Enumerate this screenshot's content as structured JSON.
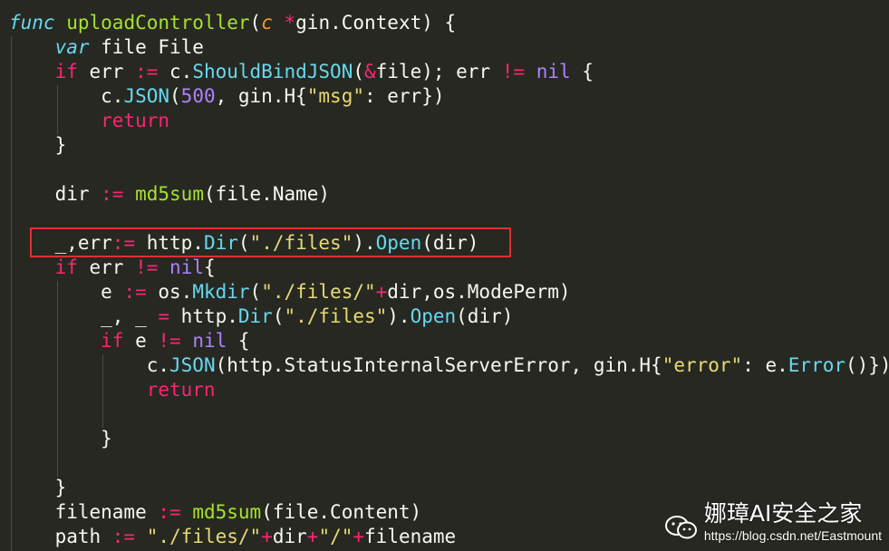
{
  "colors": {
    "background": "#272822",
    "keyword_blue": "#66d9ef",
    "keyword_pink": "#f92672",
    "function_green": "#a6e22e",
    "string_yellow": "#e6db74",
    "number_purple": "#ae81ff",
    "plain": "#f8f8f2",
    "param_orange": "#fd971f",
    "highlight_border": "#e03030"
  },
  "code": {
    "lines": [
      [
        [
          "func",
          "kwblue_i"
        ],
        [
          " ",
          "plain"
        ],
        [
          "uploadController",
          "fn"
        ],
        [
          "(",
          "plain"
        ],
        [
          "c",
          "param"
        ],
        [
          " ",
          "plain"
        ],
        [
          "*",
          "pink"
        ],
        [
          "gin.Context) {",
          "plain"
        ]
      ],
      [
        [
          "    ",
          "plain"
        ],
        [
          "var",
          "kwblue_i"
        ],
        [
          " file File",
          "plain"
        ]
      ],
      [
        [
          "    ",
          "plain"
        ],
        [
          "if",
          "pink"
        ],
        [
          " err ",
          "plain"
        ],
        [
          ":=",
          "pink"
        ],
        [
          " c.",
          "plain"
        ],
        [
          "ShouldBindJSON",
          "blue"
        ],
        [
          "(",
          "plain"
        ],
        [
          "&",
          "pink"
        ],
        [
          "file); err ",
          "plain"
        ],
        [
          "!=",
          "pink"
        ],
        [
          " ",
          "plain"
        ],
        [
          "nil",
          "purple"
        ],
        [
          " {",
          "plain"
        ]
      ],
      [
        [
          "        c.",
          "plain"
        ],
        [
          "JSON",
          "blue"
        ],
        [
          "(",
          "plain"
        ],
        [
          "500",
          "purple"
        ],
        [
          ", gin.H{",
          "plain"
        ],
        [
          "\"msg\"",
          "str"
        ],
        [
          ": err})",
          "plain"
        ]
      ],
      [
        [
          "        ",
          "plain"
        ],
        [
          "return",
          "pink"
        ]
      ],
      [
        [
          "    }",
          "plain"
        ]
      ],
      [
        [
          "",
          "plain"
        ]
      ],
      [
        [
          "    dir ",
          "plain"
        ],
        [
          ":=",
          "pink"
        ],
        [
          " ",
          "plain"
        ],
        [
          "md5sum",
          "fn"
        ],
        [
          "(file.Name)",
          "plain"
        ]
      ],
      [
        [
          "",
          "plain"
        ]
      ],
      [
        [
          "    _,err",
          "plain"
        ],
        [
          ":=",
          "pink"
        ],
        [
          " http.",
          "plain"
        ],
        [
          "Dir",
          "blue"
        ],
        [
          "(",
          "plain"
        ],
        [
          "\"./files\"",
          "str"
        ],
        [
          ").",
          "plain"
        ],
        [
          "Open",
          "blue"
        ],
        [
          "(dir)",
          "plain"
        ]
      ],
      [
        [
          "    ",
          "plain"
        ],
        [
          "if",
          "pink"
        ],
        [
          " err ",
          "plain"
        ],
        [
          "!=",
          "pink"
        ],
        [
          " ",
          "plain"
        ],
        [
          "nil",
          "purple"
        ],
        [
          "{",
          "plain"
        ]
      ],
      [
        [
          "        e ",
          "plain"
        ],
        [
          ":=",
          "pink"
        ],
        [
          " os.",
          "plain"
        ],
        [
          "Mkdir",
          "blue"
        ],
        [
          "(",
          "plain"
        ],
        [
          "\"./files/\"",
          "str"
        ],
        [
          "+",
          "pink"
        ],
        [
          "dir,os.ModePerm)",
          "plain"
        ]
      ],
      [
        [
          "        _, _ ",
          "plain"
        ],
        [
          "=",
          "pink"
        ],
        [
          " http.",
          "plain"
        ],
        [
          "Dir",
          "blue"
        ],
        [
          "(",
          "plain"
        ],
        [
          "\"./files\"",
          "str"
        ],
        [
          ").",
          "plain"
        ],
        [
          "Open",
          "blue"
        ],
        [
          "(dir)",
          "plain"
        ]
      ],
      [
        [
          "        ",
          "plain"
        ],
        [
          "if",
          "pink"
        ],
        [
          " e ",
          "plain"
        ],
        [
          "!=",
          "pink"
        ],
        [
          " ",
          "plain"
        ],
        [
          "nil",
          "purple"
        ],
        [
          " {",
          "plain"
        ]
      ],
      [
        [
          "            c.",
          "plain"
        ],
        [
          "JSON",
          "blue"
        ],
        [
          "(http.StatusInternalServerError, gin.H{",
          "plain"
        ],
        [
          "\"error\"",
          "str"
        ],
        [
          ": e.",
          "plain"
        ],
        [
          "Error",
          "blue"
        ],
        [
          "()})",
          "plain"
        ]
      ],
      [
        [
          "            ",
          "plain"
        ],
        [
          "return",
          "pink"
        ]
      ],
      [
        [
          "",
          "plain"
        ]
      ],
      [
        [
          "        }",
          "plain"
        ]
      ],
      [
        [
          "",
          "plain"
        ]
      ],
      [
        [
          "    }",
          "plain"
        ]
      ],
      [
        [
          "    filename ",
          "plain"
        ],
        [
          ":=",
          "pink"
        ],
        [
          " ",
          "plain"
        ],
        [
          "md5sum",
          "fn"
        ],
        [
          "(file.Content)",
          "plain"
        ]
      ],
      [
        [
          "    path ",
          "plain"
        ],
        [
          ":=",
          "pink"
        ],
        [
          " ",
          "plain"
        ],
        [
          "\"./files/\"",
          "str"
        ],
        [
          "+",
          "pink"
        ],
        [
          "dir",
          "plain"
        ],
        [
          "+",
          "pink"
        ],
        [
          "\"/\"",
          "str"
        ],
        [
          "+",
          "pink"
        ],
        [
          "filename",
          "plain"
        ]
      ]
    ]
  },
  "watermark": {
    "brand": "娜璋AI安全之家",
    "url": "https://blog.csdn.net/Eastmount",
    "icon": "wechat-icon"
  }
}
